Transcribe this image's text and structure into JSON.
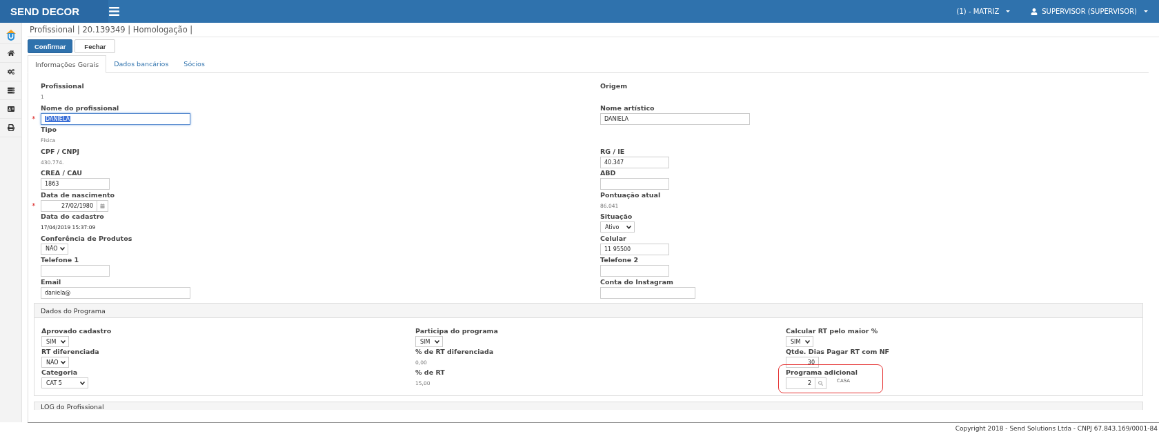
{
  "header": {
    "brand": "SEND DECOR",
    "branch": "(1) - MATRIZ",
    "user": "SUPERVISOR (SUPERVISOR)"
  },
  "breadcrumb": "Profissional | 20.139349 | Homologação |",
  "buttons": [
    {
      "label": "Confirmar",
      "kind": "primary"
    },
    {
      "label": "Fechar",
      "kind": "default"
    }
  ],
  "tabs": [
    {
      "label": "Informações Gerais",
      "selected": true
    },
    {
      "label": "Dados bancários",
      "selected": false
    },
    {
      "label": "Sócios",
      "selected": false
    }
  ],
  "form_rows": [
    {
      "left": {
        "label": "Profissional",
        "kind": "text",
        "value": "1"
      },
      "right": {
        "label": "Origem",
        "kind": "text"
      }
    },
    {
      "left": {
        "label": "Nome do profissional",
        "kind": "input-wide",
        "value": "DANIELA",
        "required_mark": "*",
        "focused": true
      },
      "right": {
        "label": "Nome artístico",
        "kind": "input-long",
        "value": "DANIELA",
        "focused": false
      }
    },
    {
      "left": {
        "label": "Tipo",
        "kind": "text",
        "value": "Física"
      }
    },
    {
      "left": {
        "label": "CPF / CNPJ",
        "kind": "text",
        "value": "430.774."
      },
      "right": {
        "label": "RG / IE",
        "kind": "input",
        "value": "40.347",
        "focused": false
      }
    },
    {
      "left": {
        "label": "CREA / CAU",
        "kind": "input",
        "value": "1863",
        "focused": false
      },
      "right": {
        "label": "ABD",
        "kind": "input",
        "focused": false
      }
    },
    {
      "left": {
        "label": "Data de nascimento",
        "kind": "date",
        "value": "27/02/1980",
        "required_mark": "*",
        "focused": false
      },
      "right": {
        "label": "Pontuação atual",
        "kind": "text",
        "value": "86.041"
      }
    },
    {
      "left": {
        "label": "Data do cadastro",
        "kind": "text-dark",
        "value": "17/04/2019 15:37:09"
      },
      "right": {
        "label": "Situação",
        "kind": "select",
        "value": "Ativo"
      }
    },
    {
      "left": {
        "label": "Conferência de Produtos",
        "kind": "select",
        "value": "NÃO"
      },
      "right": {
        "label": "Celular",
        "kind": "input",
        "value": "11 95500",
        "focused": false
      }
    },
    {
      "left": {
        "label": "Telefone 1",
        "kind": "input",
        "focused": false
      },
      "right": {
        "label": "Telefone 2",
        "kind": "input",
        "focused": false
      }
    },
    {
      "left": {
        "label": "Email",
        "kind": "input-wide",
        "value": "daniela@",
        "focused": false
      },
      "right": {
        "label": "Conta do Instagram",
        "kind": "input-mid",
        "focused": false
      }
    }
  ],
  "program": {
    "title": "Dados do Programa",
    "columns": [
      [
        {
          "label": "Aprovado cadastro",
          "kind": "select",
          "value": "SIM"
        },
        {
          "label": "RT diferenciada",
          "kind": "select",
          "value": "NÃO"
        },
        {
          "label": "Categoria",
          "kind": "select-wide",
          "value": "CAT 5"
        }
      ],
      [
        {
          "label": "Participa do programa",
          "kind": "select",
          "value": "SIM"
        },
        {
          "label": "% de RT diferenciada",
          "kind": "text",
          "value": "0,00"
        },
        {
          "label": "% de RT",
          "kind": "text",
          "value": "15,00"
        }
      ],
      [
        {
          "label": "Calcular RT pelo maior %",
          "kind": "select",
          "value": "SIM"
        },
        {
          "label": "Qtde. Dias Pagar RT com NF",
          "kind": "number",
          "value": "30"
        },
        {
          "label": "Programa adicional",
          "kind": "lookup",
          "value": "2",
          "description": "CASA",
          "highlighted": true
        }
      ]
    ]
  },
  "log_section": {
    "title": "LOG do Profissional"
  },
  "footer": "Copyright 2018 - Send Solutions Ltda - CNPJ 67.843.169/0001-84"
}
